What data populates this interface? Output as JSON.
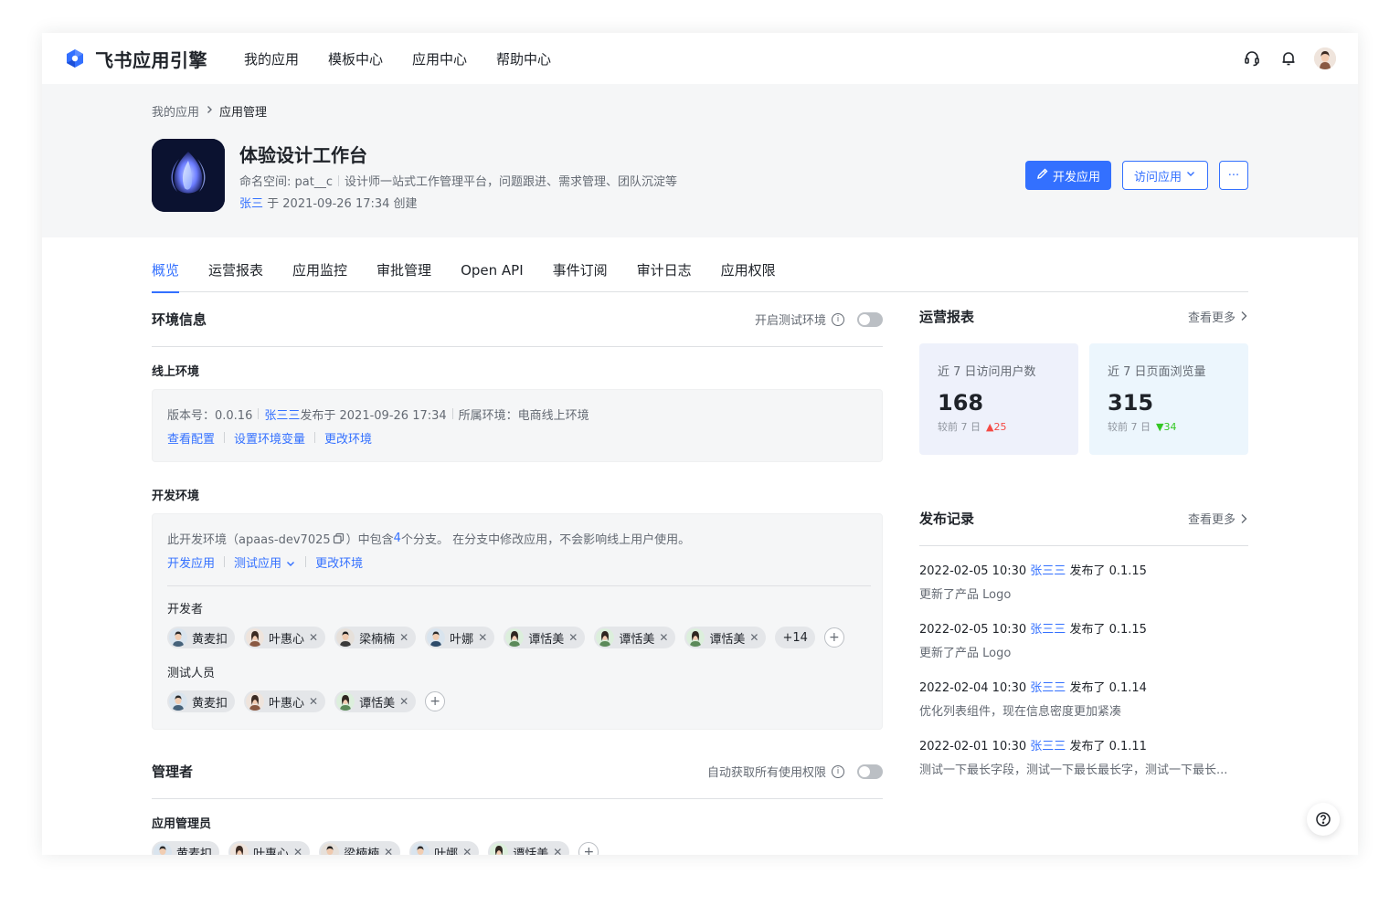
{
  "nav": {
    "brand": "飞书应用引擎",
    "items": [
      "我的应用",
      "模板中心",
      "应用中心",
      "帮助中心"
    ]
  },
  "breadcrumb": {
    "parent": "我的应用",
    "current": "应用管理"
  },
  "app": {
    "title": "体验设计工作台",
    "namespace": "命名空间: pat__c",
    "description": "设计师一站式工作管理平台，问题跟进、需求管理、团队沉淀等",
    "creator": "张三",
    "created_text": " 于 2021-09-26 17:34 创建"
  },
  "actions": {
    "develop": "开发应用",
    "visit": "访问应用",
    "more": "···"
  },
  "tabs": [
    "概览",
    "运营报表",
    "应用监控",
    "审批管理",
    "Open API",
    "事件订阅",
    "审计日志",
    "应用权限"
  ],
  "env": {
    "title": "环境信息",
    "toggle_label": "开启测试环境",
    "online": {
      "title": "线上环境",
      "version": "版本号：0.0.16",
      "publisher": "张三三",
      "published": " 发布于 2021-09-26 17:34",
      "env_label": "所属环境：电商线上环境",
      "links": [
        "查看配置",
        "设置环境变量",
        "更改环境"
      ]
    },
    "dev": {
      "title": "开发环境",
      "desc_pre": "此开发环境（apaas-dev7025",
      "desc_mid": "）中包含 ",
      "branch_count": "4",
      "desc_post": " 个分支。 在分支中修改应用，不会影响线上用户使用。",
      "links": [
        "开发应用",
        "测试应用",
        "更改环境"
      ],
      "developers_label": "开发者",
      "developers": [
        "黄麦扣",
        "叶惠心",
        "梁楠楠",
        "叶娜",
        "谭恬美",
        "谭恬美",
        "谭恬美"
      ],
      "developers_more": "+14",
      "testers_label": "测试人员",
      "testers": [
        "黄麦扣",
        "叶惠心",
        "谭恬美"
      ]
    }
  },
  "admin": {
    "title": "管理者",
    "toggle_label": "自动获取所有使用权限",
    "sub_title": "应用管理员",
    "people": [
      "黄麦扣",
      "叶惠心",
      "梁楠楠",
      "叶娜",
      "谭恬美"
    ]
  },
  "ops": {
    "title": "运营报表",
    "more": "查看更多",
    "cards": [
      {
        "label": "近 7 日访问用户数",
        "value": "168",
        "cmp": "较前 7 日",
        "delta": "25"
      },
      {
        "label": "近 7 日页面浏览量",
        "value": "315",
        "cmp": "较前 7 日",
        "delta": "34"
      }
    ]
  },
  "releases": {
    "title": "发布记录",
    "more": "查看更多",
    "items": [
      {
        "time": "2022-02-05 10:30",
        "user": "张三三",
        "action": " 发布了 0.1.15",
        "desc": "更新了产品 Logo"
      },
      {
        "time": "2022-02-05 10:30",
        "user": "张三三",
        "action": " 发布了 0.1.15",
        "desc": "更新了产品 Logo"
      },
      {
        "time": "2022-02-04 10:30",
        "user": "张三三",
        "action": " 发布了 0.1.14",
        "desc": "优化列表组件，现在信息密度更加紧凑"
      },
      {
        "time": "2022-02-01 10:30",
        "user": "张三三",
        "action": " 发布了 0.1.11",
        "desc": "测试一下最长字段，测试一下最长最长字，测试一下最长..."
      }
    ]
  },
  "colors": {
    "accent": "#3370ff",
    "up": "#f54a45",
    "down": "#34c724"
  }
}
